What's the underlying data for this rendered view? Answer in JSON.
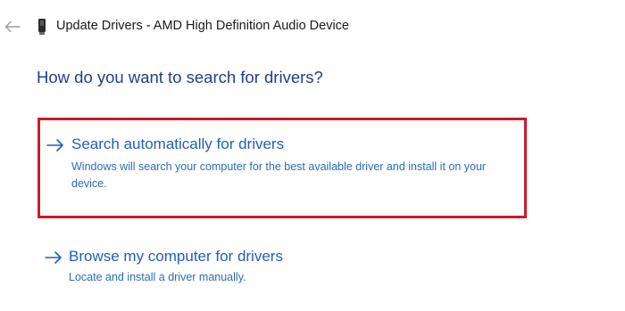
{
  "window": {
    "title": "Update Drivers - AMD High Definition Audio Device"
  },
  "heading": "How do you want to search for drivers?",
  "options": [
    {
      "title": "Search automatically for drivers",
      "description": "Windows will search your computer for the best available driver and install it on your device.",
      "highlighted": true
    },
    {
      "title": "Browse my computer for drivers",
      "description": "Locate and install a driver manually.",
      "highlighted": false
    }
  ],
  "icons": {
    "back": "back-arrow-icon",
    "device": "device-icon",
    "option_arrow": "right-arrow-icon"
  },
  "colors": {
    "heading": "#1f3f8c",
    "link": "#1f5fbf",
    "highlight_border": "#d0192b"
  }
}
